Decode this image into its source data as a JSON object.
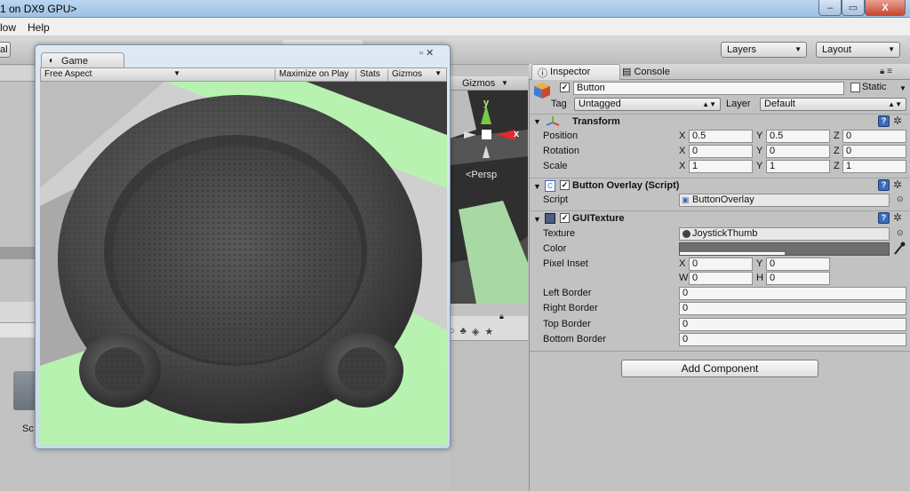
{
  "window": {
    "title": "1 on DX9 GPU>",
    "min": "–",
    "max": "▭",
    "close": "X"
  },
  "menu": {
    "items": [
      "low",
      "Help"
    ]
  },
  "toolbar": {
    "left_fragment": "al",
    "layers": "Layers",
    "layout": "Layout"
  },
  "game": {
    "tab_label": "Game",
    "aspect": "Free Aspect",
    "maximize": "Maximize on Play",
    "stats": "Stats",
    "gizmos": "Gizmos"
  },
  "scene": {
    "gizmos": "Gizmos",
    "persp": "<Persp",
    "axis_y": "y",
    "axis_x": "x"
  },
  "left_panel": {
    "project_label": "Sc"
  },
  "inspector": {
    "tab": "Inspector",
    "console_tab": "Console",
    "object_name": "Button",
    "static_label": "Static",
    "tag_label": "Tag",
    "tag_value": "Untagged",
    "layer_label": "Layer",
    "layer_value": "Default",
    "transform": {
      "title": "Transform",
      "position": {
        "label": "Position",
        "x": "0.5",
        "y": "0.5",
        "z": "0"
      },
      "rotation": {
        "label": "Rotation",
        "x": "0",
        "y": "0",
        "z": "0"
      },
      "scale": {
        "label": "Scale",
        "x": "1",
        "y": "1",
        "z": "1"
      }
    },
    "button_overlay": {
      "title": "Button Overlay (Script)",
      "script_label": "Script",
      "script_value": "ButtonOverlay"
    },
    "gui_texture": {
      "title": "GUITexture",
      "texture_label": "Texture",
      "texture_value": "JoystickThumb",
      "color_label": "Color",
      "pixel_inset_label": "Pixel Inset",
      "inset_x": "0",
      "inset_y": "0",
      "inset_w": "0",
      "inset_h": "0",
      "left_border_label": "Left Border",
      "left_border": "0",
      "right_border_label": "Right Border",
      "right_border": "0",
      "top_border_label": "Top Border",
      "top_border": "0",
      "bottom_border_label": "Bottom Border",
      "bottom_border": "0"
    },
    "add_component": "Add Component"
  },
  "axis_labels": {
    "x": "X",
    "y": "Y",
    "z": "Z",
    "w": "W",
    "h": "H"
  },
  "colors": {
    "green_plane": "#b8f2b0",
    "scene_bg": "#4b4b4b",
    "panel_bg": "#c2c2c2",
    "help_blue": "#3b6db5"
  },
  "icons": [
    "gameobject-cube-icon",
    "transform-icon",
    "script-icon",
    "guitexture-icon",
    "gear-icon",
    "help-icon",
    "eyedropper-icon",
    "lock-icon"
  ]
}
